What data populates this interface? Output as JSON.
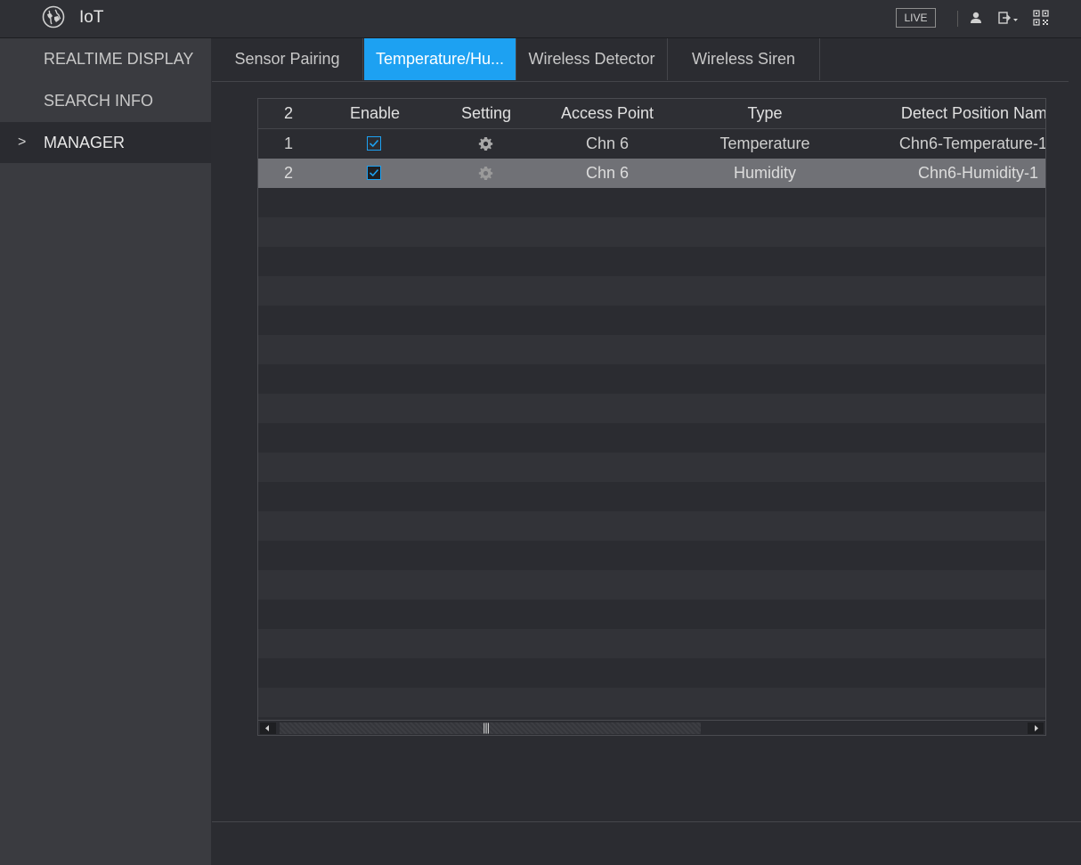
{
  "header": {
    "title": "IoT",
    "live_label": "LIVE"
  },
  "sidebar": {
    "items": [
      {
        "label": "REALTIME DISPLAY"
      },
      {
        "label": "SEARCH INFO"
      },
      {
        "label": "MANAGER",
        "chevron": ">"
      }
    ]
  },
  "tabs": [
    {
      "label": "Sensor Pairing"
    },
    {
      "label": "Temperature/Hu..."
    },
    {
      "label": "Wireless Detector"
    },
    {
      "label": "Wireless Siren"
    }
  ],
  "table": {
    "columns": [
      "2",
      "Enable",
      "Setting",
      "Access Point",
      "Type",
      "Detect Position Nam"
    ],
    "rows": [
      {
        "index": "1",
        "enabled": true,
        "access_point": "Chn 6",
        "type": "Temperature",
        "position": "Chn6-Temperature-1"
      },
      {
        "index": "2",
        "enabled": true,
        "access_point": "Chn 6",
        "type": "Humidity",
        "position": "Chn6-Humidity-1"
      }
    ],
    "selected_row": 2,
    "scroll_grip": "|||"
  },
  "colors": {
    "accent": "#1da1f2",
    "background": "#2b2c31",
    "sidebar": "#3a3b40",
    "selected_row": "#707176"
  }
}
